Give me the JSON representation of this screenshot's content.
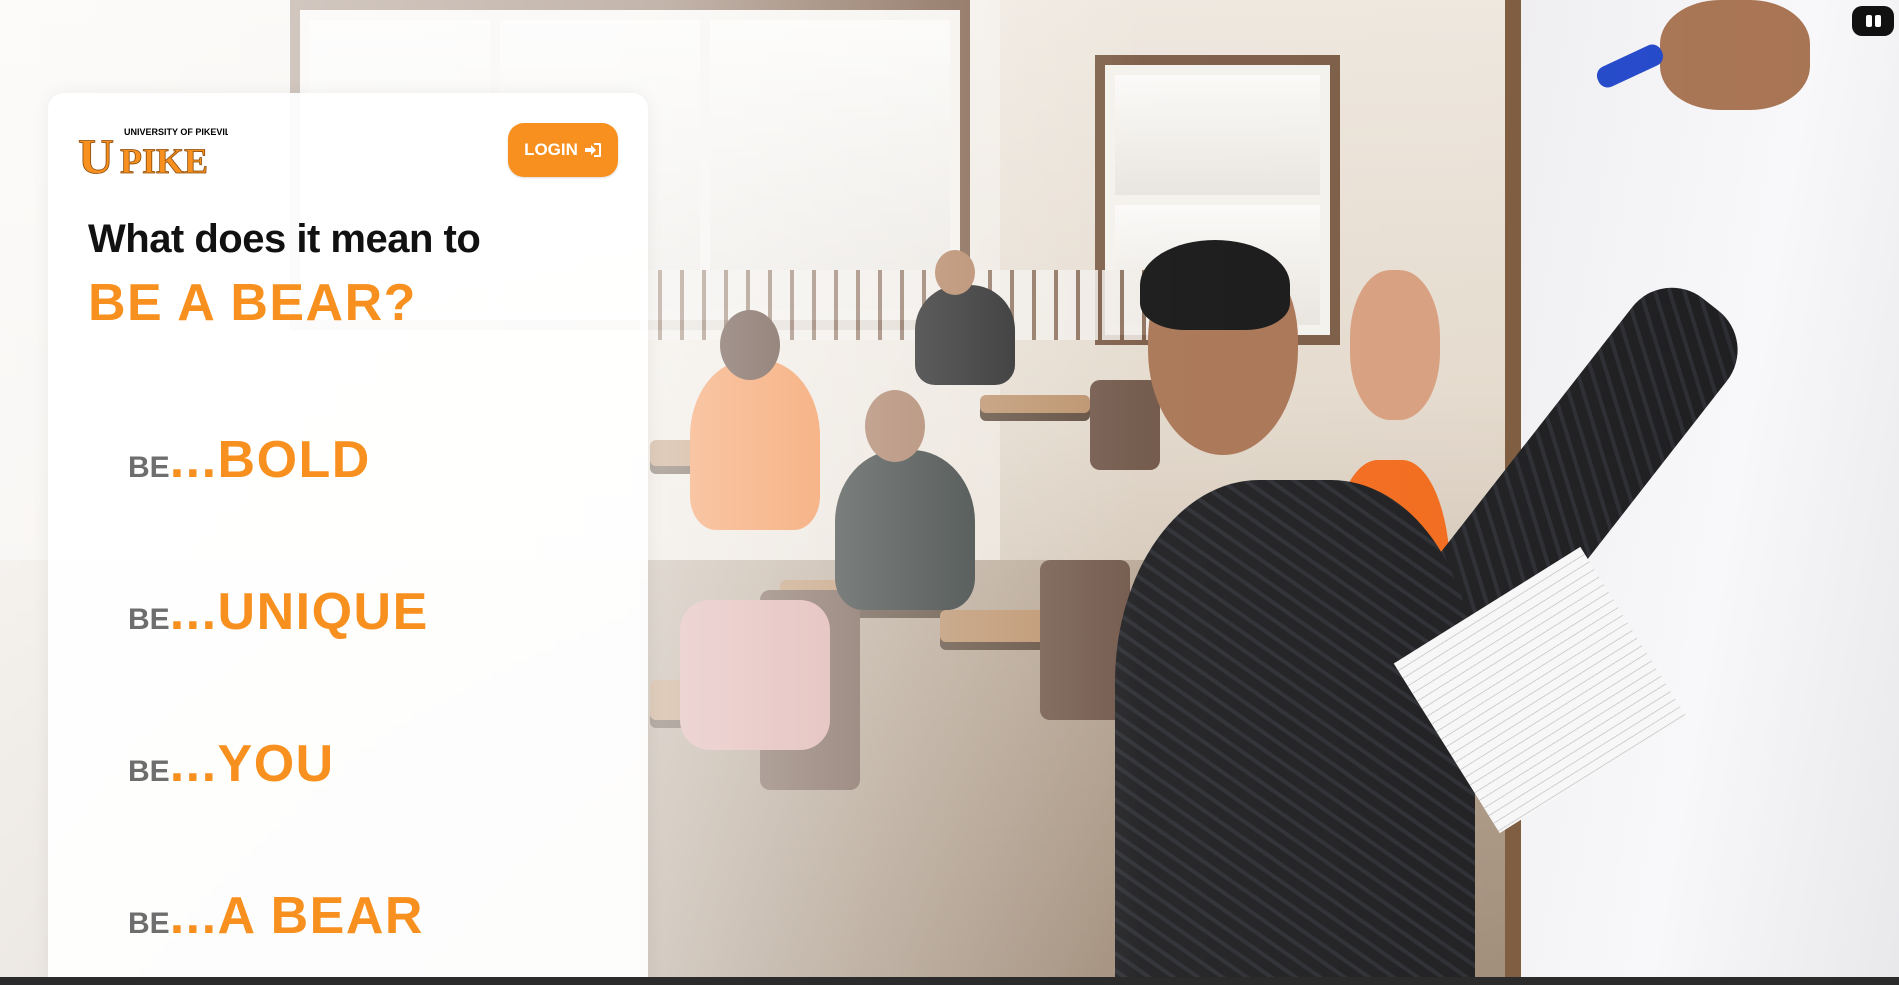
{
  "logo": {
    "small_text": "UNIVERSITY OF PIKEVILLE",
    "big_text": "UPIKE",
    "color": "#f7901e"
  },
  "login": {
    "label": "LOGIN",
    "icon": "sign-in-icon"
  },
  "headline": "What does it mean to",
  "subhead": "BE A BEAR?",
  "be_items": [
    {
      "prefix": "BE",
      "word": "...BOLD"
    },
    {
      "prefix": "BE",
      "word": "...UNIQUE"
    },
    {
      "prefix": "BE",
      "word": "...YOU"
    },
    {
      "prefix": "BE",
      "word": "...A BEAR"
    }
  ],
  "colors": {
    "accent": "#f7901e",
    "prefix_gray": "#6e6e6e",
    "headline": "#111111"
  },
  "background": {
    "icon": "classroom-photo"
  },
  "corner_badge": {
    "icon": "accessibility-widget-icon"
  }
}
